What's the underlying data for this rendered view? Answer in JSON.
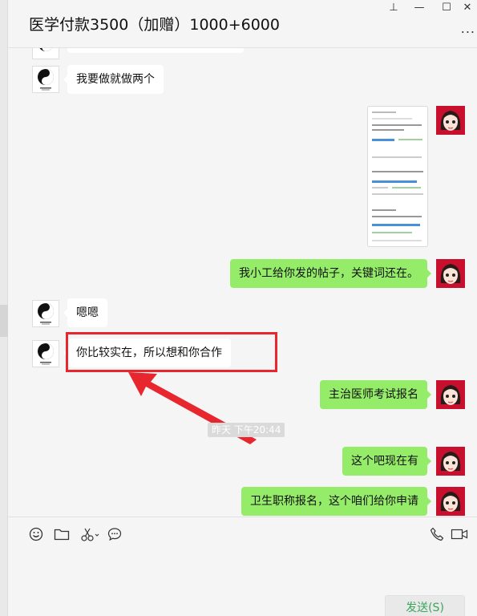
{
  "window": {
    "title": "医学付款3500（加赠）1000+6000",
    "controls": {
      "pin": "⊥",
      "minimize": "—",
      "maximize": "☐",
      "close": "✕"
    },
    "more": "..."
  },
  "messages": [
    {
      "side": "left",
      "text": "我要做就做两个"
    },
    {
      "side": "right",
      "type": "image"
    },
    {
      "side": "right",
      "text": "我小工给你发的帖子，关键词还在。"
    },
    {
      "side": "left",
      "text": "嗯嗯"
    },
    {
      "side": "left",
      "text": "你比较实在，所以想和你合作"
    },
    {
      "side": "right",
      "text": "主治医师考试报名"
    },
    {
      "side": "right",
      "text": "这个吧现在有"
    },
    {
      "side": "right",
      "text": "卫生职称报名，这个咱们给你申请"
    }
  ],
  "timestamp": "昨天 下午20:44",
  "annotation": {
    "color": "#e8262d"
  },
  "toolbar": {
    "icons": [
      "emoji-icon",
      "folder-icon",
      "scissors-icon",
      "chat-bubble-icon",
      "phone-icon",
      "video-icon"
    ],
    "send_label": "发送(S)"
  },
  "colors": {
    "bubble_self": "#95ec69",
    "bubble_other": "#ffffff",
    "background": "#f5f5f5",
    "send_text": "#3aa65a"
  }
}
